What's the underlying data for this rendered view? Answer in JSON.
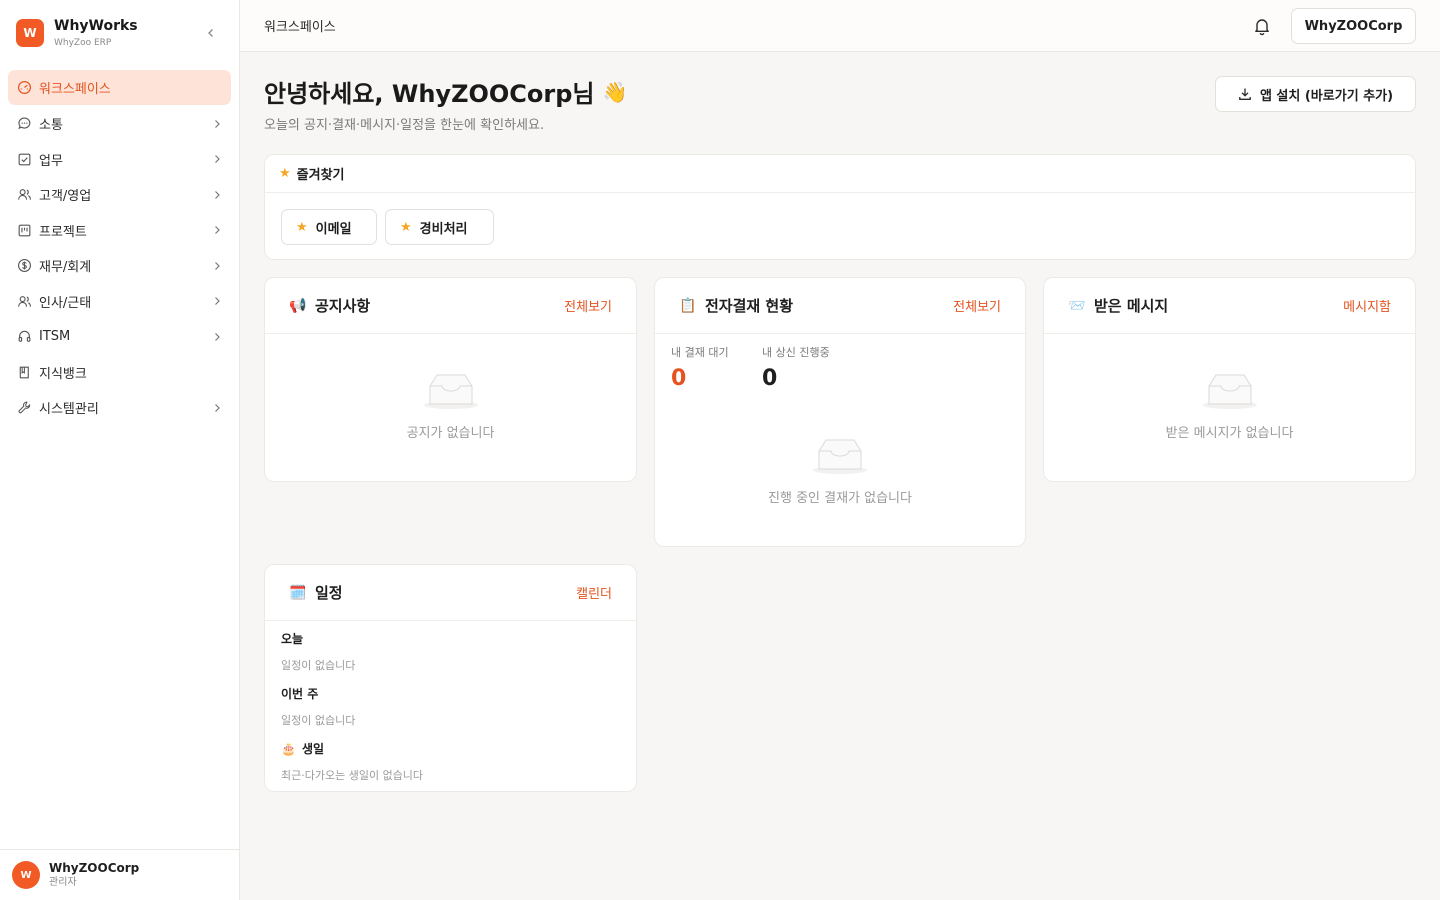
{
  "brand": {
    "logo_letter": "W",
    "title": "WhyWorks",
    "subtitle": "WhyZoo ERP"
  },
  "sidebar": {
    "items": [
      {
        "label": "워크스페이스",
        "icon": "dashboard-icon",
        "active": true,
        "has_children": false
      },
      {
        "label": "소통",
        "icon": "chat-icon",
        "has_children": true
      },
      {
        "label": "업무",
        "icon": "checkbox-icon",
        "has_children": true
      },
      {
        "label": "고객/영업",
        "icon": "users-icon",
        "has_children": true
      },
      {
        "label": "프로젝트",
        "icon": "kanban-icon",
        "has_children": true
      },
      {
        "label": "재무/회계",
        "icon": "dollar-icon",
        "has_children": true
      },
      {
        "label": "인사/근태",
        "icon": "people-icon",
        "has_children": true
      },
      {
        "label": "ITSM",
        "icon": "headset-icon",
        "has_children": true
      },
      {
        "label": "지식뱅크",
        "icon": "book-icon",
        "has_children": false
      },
      {
        "label": "시스템관리",
        "icon": "wrench-icon",
        "has_children": true
      }
    ]
  },
  "user": {
    "avatar_letter": "W",
    "name": "WhyZOOCorp",
    "role": "관리자"
  },
  "topbar": {
    "breadcrumb": "워크스페이스",
    "org_button": "WhyZOOCorp"
  },
  "main": {
    "greeting": "안녕하세요, WhyZOOCorp님",
    "greeting_emoji": "👋",
    "subtitle": "오늘의 공지·결재·메시지·일정을 한눈에 확인하세요.",
    "install_button": "앱 설치 (바로가기 추가)"
  },
  "favorites": {
    "title": "즐겨찾기",
    "items": [
      "이메일",
      "경비처리"
    ]
  },
  "notices": {
    "emoji": "📢",
    "title": "공지사항",
    "link": "전체보기",
    "empty": "공지가 없습니다"
  },
  "approval": {
    "emoji": "📋",
    "title": "전자결재 현황",
    "link": "전체보기",
    "my_pending_label": "내 결재 대기",
    "my_pending_value": "0",
    "my_requested_label": "내 상신 진행중",
    "my_requested_value": "0",
    "empty": "진행 중인 결재가 없습니다"
  },
  "messages": {
    "emoji": "📨",
    "title": "받은 메시지",
    "link": "메시지함",
    "empty": "받은 메시지가 없습니다"
  },
  "schedule": {
    "emoji": "🗓️",
    "title": "일정",
    "link": "캘린더",
    "today_label": "오늘",
    "today_empty": "일정이 없습니다",
    "week_label": "이번 주",
    "week_empty": "일정이 없습니다",
    "birthday_emoji": "🎂",
    "birthday_label": "생일",
    "birthday_empty": "최근·다가오는 생일이 없습니다"
  },
  "colors": {
    "accent": "#e5531f",
    "active_bg": "#fde3d8",
    "brand": "#f15a24"
  }
}
